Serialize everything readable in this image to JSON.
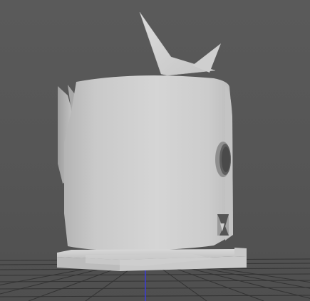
{
  "viewport": {
    "mode": "perspective",
    "shading": "smooth-shaded",
    "colors": {
      "background": "#555555",
      "grid_line": "#2f2f2f",
      "model_light": "#d4d4d4",
      "model_mid": "#b8b8b8",
      "model_dark": "#8a8a8a",
      "axis_y": "#3a3ad0"
    },
    "scene": {
      "grid": true,
      "object_name": "tower-model",
      "features": [
        "cylindrical-body",
        "spike-crown",
        "window-hole",
        "tooth-notch",
        "base-platform"
      ]
    }
  }
}
